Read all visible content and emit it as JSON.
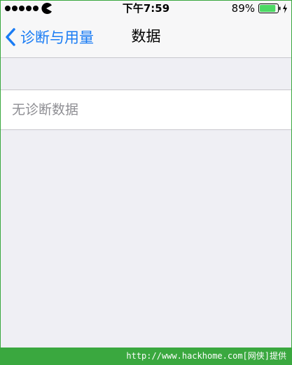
{
  "status_bar": {
    "signal_icon": "signal-dots-icon",
    "carrier_icon": "pacman-carrier-icon",
    "time": "下午7:59",
    "battery_percent": "89%",
    "battery_level": 0.89,
    "battery_icon": "battery-icon",
    "charging_icon": "charging-bolt-icon"
  },
  "nav_bar": {
    "back_label": "诊断与用量",
    "title": "数据"
  },
  "content": {
    "empty_message": "无诊断数据"
  },
  "footer": {
    "watermark": "http://www.hackhome.com[网侠]提供"
  },
  "colors": {
    "accent": "#1a7cf4",
    "background": "#efeff4",
    "battery": "#4cd964",
    "frame": "#3aa83f"
  }
}
